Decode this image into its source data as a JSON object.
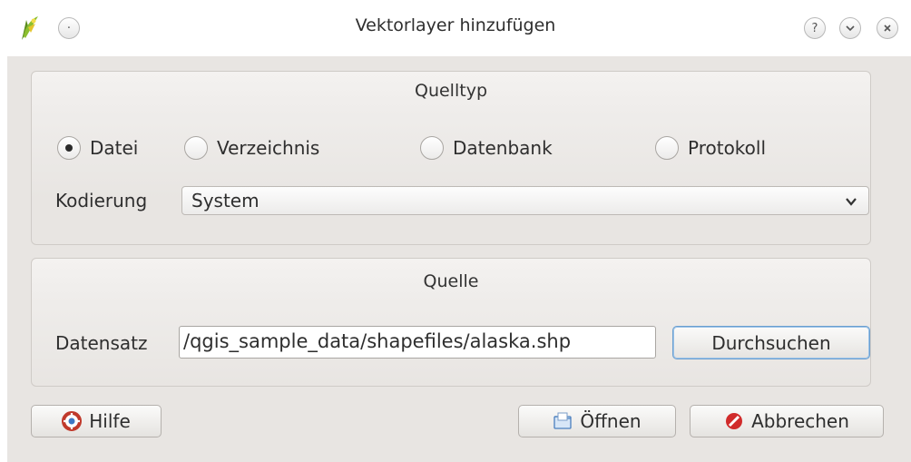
{
  "window": {
    "title": "Vektorlayer hinzufügen",
    "icons": [
      "qgis-app-icon",
      "menu-icon",
      "help-icon",
      "minimize-icon",
      "close-icon"
    ]
  },
  "source_type": {
    "title": "Quelltyp",
    "options": [
      {
        "label": "Datei",
        "selected": true
      },
      {
        "label": "Verzeichnis",
        "selected": false
      },
      {
        "label": "Datenbank",
        "selected": false
      },
      {
        "label": "Protokoll",
        "selected": false
      }
    ],
    "encoding_label": "Kodierung",
    "encoding_value": "System"
  },
  "source": {
    "title": "Quelle",
    "dataset_label": "Datensatz",
    "dataset_value": "/qgis_sample_data/shapefiles/alaska.shp",
    "browse_label": "Durchsuchen"
  },
  "buttons": {
    "help_label": "Hilfe",
    "open_label": "Öffnen",
    "cancel_label": "Abbrechen"
  },
  "colors": {
    "dialog_bg": "#e8e5e2",
    "focus_border": "#6a9fd0",
    "cancel_red": "#d12b2b"
  }
}
